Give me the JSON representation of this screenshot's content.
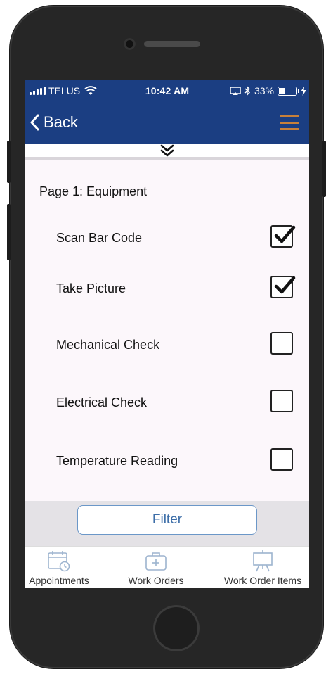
{
  "status_bar": {
    "carrier": "TELUS",
    "time": "10:42 AM",
    "battery": "33%"
  },
  "nav": {
    "back_label": "Back"
  },
  "form": {
    "page_title": "Page 1: Equipment",
    "items": [
      {
        "label": "Scan Bar Code",
        "checked": true
      },
      {
        "label": "Take Picture",
        "checked": true
      },
      {
        "label": "Mechanical Check",
        "checked": false
      },
      {
        "label": "Electrical Check",
        "checked": false
      },
      {
        "label": "Temperature Reading",
        "checked": false
      }
    ]
  },
  "filter": {
    "label": "Filter"
  },
  "tabs": [
    {
      "label": "Appointments",
      "icon": "calendar-icon"
    },
    {
      "label": "Work Orders",
      "icon": "toolbox-icon"
    },
    {
      "label": "Work Order Items",
      "icon": "easel-icon"
    }
  ],
  "colors": {
    "header_bg": "#1b3e82",
    "menu_accent": "#c8803a",
    "filter_border": "#6b97c8",
    "filter_text": "#3d6ea8"
  }
}
